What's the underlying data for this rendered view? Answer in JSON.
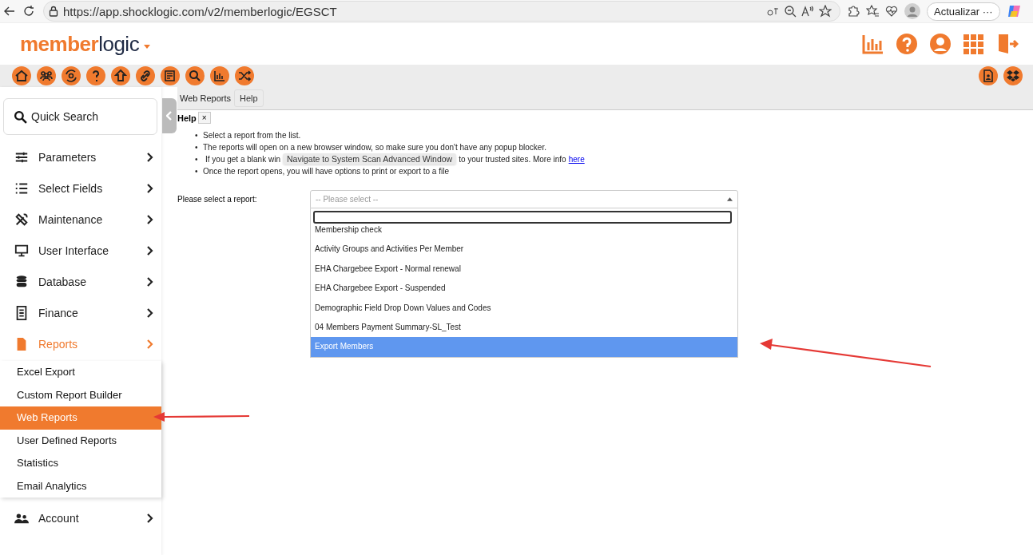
{
  "browser": {
    "url": "https://app.shocklogic.com/v2/memberlogic/EGSCT",
    "update_button": "Actualizar",
    "more": "···"
  },
  "header": {
    "logo_bold": "member",
    "logo_light": "logic"
  },
  "sidebar": {
    "search": {
      "placeholder": "Quick Search"
    },
    "items": [
      {
        "label": "Parameters",
        "selected": false
      },
      {
        "label": "Select Fields",
        "selected": false
      },
      {
        "label": "Maintenance",
        "selected": false
      },
      {
        "label": "User Interface",
        "selected": false
      },
      {
        "label": "Database",
        "selected": false
      },
      {
        "label": "Finance",
        "selected": false
      },
      {
        "label": "Reports",
        "selected": true,
        "children": [
          {
            "label": "Excel Export",
            "selected": false
          },
          {
            "label": "Custom Report Builder",
            "selected": false
          },
          {
            "label": "Web Reports",
            "selected": true
          },
          {
            "label": "User Defined Reports",
            "selected": false
          },
          {
            "label": "Statistics",
            "selected": false
          },
          {
            "label": "Email Analytics",
            "selected": false
          }
        ]
      },
      {
        "label": "Account",
        "selected": false
      }
    ]
  },
  "tabs": [
    {
      "label": "Web Reports",
      "selected": true
    },
    {
      "label": "Help",
      "selected": false
    }
  ],
  "help": {
    "title": "Help",
    "close": "×",
    "marker": "•",
    "bullets": [
      "Select a report from the list.",
      "The reports will open on a new browser window, so make sure you don't have any popup blocker."
    ],
    "bullet_partial": {
      "before": "If you get a blank win",
      "tooltip": "Navigate to System Scan Advanced Window",
      "after": "to your trusted sites. More info",
      "link": "here"
    },
    "bullets_after": [
      "Once the report opens, you will have options to print or export to a file"
    ]
  },
  "report_select": {
    "label": "Please select a report:",
    "placeholder": "-- Please select --",
    "open": true,
    "options": [
      {
        "label": "Membership check",
        "selected": false
      },
      {
        "label": "Activity Groups and Activities Per Member",
        "selected": false
      },
      {
        "label": "EHA Chargebee Export - Normal renewal",
        "selected": false
      },
      {
        "label": "EHA Chargebee Export - Suspended",
        "selected": false
      },
      {
        "label": "Demographic Field Drop Down Values and Codes",
        "selected": false
      },
      {
        "label": "04 Members Payment Summary-SL_Test",
        "selected": false
      },
      {
        "label": "Export Members",
        "selected": true
      }
    ]
  }
}
